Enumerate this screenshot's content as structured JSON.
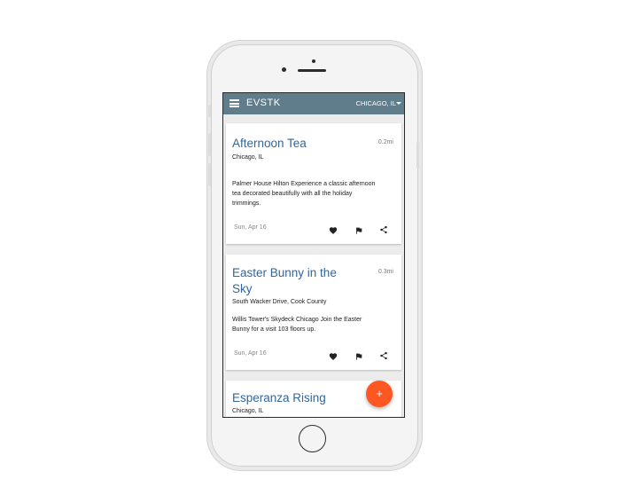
{
  "appbar": {
    "title": "EVSTK",
    "location": "CHICAGO, IL"
  },
  "events": [
    {
      "title": "Afternoon Tea",
      "distance": "0.2mi",
      "address": "Chicago, IL",
      "description_lines": [
        "Palmer House Hilton Experience a classic afternoon",
        "tea decorated beautifully with all the holiday",
        "trimmings."
      ],
      "date": "Sun, Apr 16"
    },
    {
      "title_lines": [
        "Easter Bunny in the",
        "Sky"
      ],
      "distance": "0.3mi",
      "address": "South Wacker Drive, Cook County",
      "description_lines": [
        "Willis Tower's Skydeck Chicago Join the Easter",
        "Bunny for a visit 103 floors up."
      ],
      "date": "Sun, Apr 16"
    },
    {
      "title": "Esperanza Rising",
      "address": "Chicago, IL"
    }
  ],
  "fab": {
    "label": "+"
  },
  "icons": {
    "menu": "menu-icon",
    "favorite": "heart-icon",
    "flag": "flag-icon",
    "share": "share-icon"
  },
  "colors": {
    "appbar": "#607d8b",
    "title": "#336699",
    "fab": "#ff5722"
  }
}
